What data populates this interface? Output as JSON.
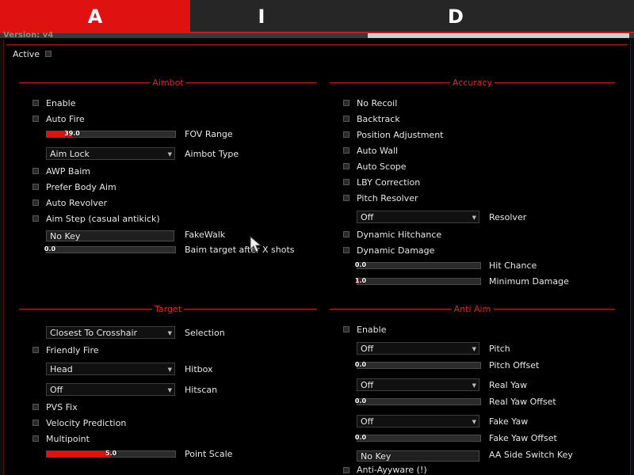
{
  "tabs": [
    {
      "label": "A",
      "active": true
    },
    {
      "label": "I",
      "active": false
    },
    {
      "label": "D",
      "active": false
    }
  ],
  "behind_text": "Version: v4",
  "active_label": "Active",
  "sections": {
    "aimbot": "Aimbot",
    "accuracy": "Accuracy",
    "target": "Target",
    "anti_aim": "Anti Aim"
  },
  "aimbot": {
    "enable": "Enable",
    "auto_fire": "Auto Fire",
    "fov_range": {
      "label": "FOV Range",
      "value": "39.0",
      "fraction": 0.2
    },
    "aimbot_type": {
      "label": "Aimbot Type",
      "value": "Aim Lock"
    },
    "awp_baim": "AWP Baim",
    "prefer_body_aim": "Prefer Body Aim",
    "auto_revolver": "Auto Revolver",
    "aim_step": "Aim Step (casual antikick)",
    "fakewalk": {
      "label": "FakeWalk",
      "value": "No Key"
    },
    "baim_after_shots": {
      "label": "Baim target after X shots",
      "value": "0.0",
      "fraction": 0.0
    }
  },
  "accuracy": {
    "no_recoil": "No Recoil",
    "backtrack": "Backtrack",
    "position_adjustment": "Position Adjustment",
    "auto_wall": "Auto Wall",
    "auto_scope": "Auto Scope",
    "lby_correction": "LBY Correction",
    "pitch_resolver": "Pitch Resolver",
    "resolver": {
      "label": "Resolver",
      "value": "Off"
    },
    "dynamic_hitchance": "Dynamic Hitchance",
    "dynamic_damage": "Dynamic Damage",
    "hit_chance": {
      "label": "Hit Chance",
      "value": "0.0",
      "fraction": 0.0
    },
    "minimum_damage": {
      "label": "Minimum Damage",
      "value": "1.0",
      "fraction": 0.01
    }
  },
  "target": {
    "selection": {
      "label": "Selection",
      "value": "Closest To Crosshair"
    },
    "friendly_fire": "Friendly Fire",
    "hitbox": {
      "label": "Hitbox",
      "value": "Head"
    },
    "hitscan": {
      "label": "Hitscan",
      "value": "Off"
    },
    "pvs_fix": "PVS Fix",
    "velocity_prediction": "Velocity Prediction",
    "multipoint": "Multipoint",
    "point_scale": {
      "label": "Point Scale",
      "value": "5.0",
      "fraction": 0.5
    }
  },
  "anti_aim": {
    "enable": "Enable",
    "pitch": {
      "label": "Pitch",
      "value": "Off"
    },
    "pitch_offset": {
      "label": "Pitch Offset",
      "value": "0.0",
      "fraction": 0.0
    },
    "real_yaw": {
      "label": "Real Yaw",
      "value": "Off"
    },
    "real_yaw_offset": {
      "label": "Real Yaw Offset",
      "value": "0.0",
      "fraction": 0.0
    },
    "fake_yaw": {
      "label": "Fake Yaw",
      "value": "Off"
    },
    "fake_yaw_offset": {
      "label": "Fake Yaw Offset",
      "value": "0.0",
      "fraction": 0.0
    },
    "aa_side_switch_key": {
      "label": "AA Side Switch Key",
      "value": "No Key"
    },
    "anti_ayyware": "Anti-Ayyware (!)"
  },
  "colors": {
    "accent": "#e01111",
    "panel": "#000000",
    "tabbar": "#262626"
  }
}
